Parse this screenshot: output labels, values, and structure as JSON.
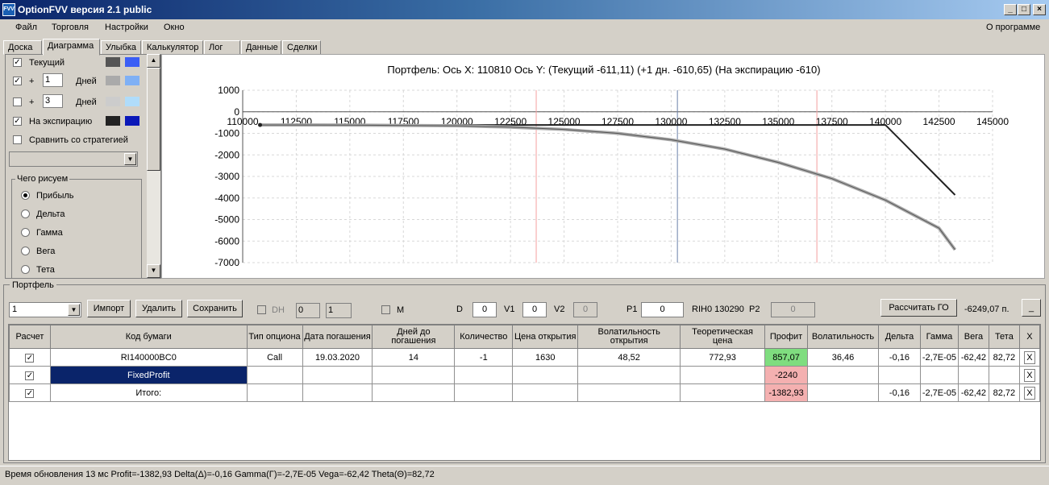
{
  "window": {
    "title": "OptionFVV версия 2.1 public",
    "icon_text": "FVV"
  },
  "menu": {
    "items": [
      "Файл",
      "Торговля",
      "Настройки",
      "Окно"
    ],
    "about": "О программе"
  },
  "tabs": [
    "Доска",
    "Диаграмма",
    "Улыбка",
    "Калькулятор",
    "Лог",
    "Данные",
    "Сделки"
  ],
  "left": {
    "current": "Текущий",
    "plus": "+",
    "days_label": "Дней",
    "days1": "1",
    "days2": "3",
    "expiry": "На экспирацию",
    "compare": "Сравнить со стратегией",
    "what_title": "Чего рисуем",
    "radios": [
      "Прибыль",
      "Дельта",
      "Гамма",
      "Вега",
      "Тета"
    ],
    "colors": {
      "current_dark": "#555555",
      "current_light": "#3b5ef5",
      "d1_dark": "#aaaaaa",
      "d1_light": "#7fb0f5",
      "d3_dark": "#cccccc",
      "d3_light": "#b0dcfa",
      "exp_dark": "#222222",
      "exp_light": "#0a18b8"
    }
  },
  "chart_title": "Портфель: Ось X: 110810 Ось Y:  (Текущий -611,11)  (+1 дн. -610,65)  (На экспирацию -610)",
  "chart_data": {
    "type": "line",
    "xlim": [
      110000,
      145000
    ],
    "ylim": [
      -7000,
      1000
    ],
    "x_ticks": [
      110000,
      112500,
      115000,
      117500,
      120000,
      122500,
      125000,
      127500,
      130000,
      132500,
      135000,
      137500,
      140000,
      142500,
      145000
    ],
    "y_ticks": [
      1000,
      0,
      -1000,
      -2000,
      -3000,
      -4000,
      -5000,
      -6000,
      -7000
    ],
    "x_tick_labels": [
      "110000",
      "112500",
      "115000",
      "117500",
      "120000",
      "122500",
      "125000",
      "127500",
      "130000",
      "132500",
      "135000",
      "137500",
      "140000",
      "142500",
      "145000"
    ],
    "y_tick_labels": [
      "1000",
      "0",
      "-1000",
      "-2000",
      "-3000",
      "-4000",
      "-5000",
      "-6000",
      "-7000"
    ],
    "vlines": [
      {
        "x": 123700,
        "color": "#f4a0a0"
      },
      {
        "x": 130290,
        "color": "#6a7fa8"
      },
      {
        "x": 136800,
        "color": "#f4a0a0"
      }
    ],
    "series": [
      {
        "color": "#222222",
        "width": 2,
        "x": [
          110810,
          140000,
          143250
        ],
        "y": [
          -610,
          -610,
          -3860
        ]
      },
      {
        "color": "#aaaaaa",
        "width": 4,
        "x": [
          110810,
          115000,
          120000,
          122500,
          125000,
          127500,
          130000,
          132500,
          135000,
          137500,
          140000,
          142500,
          143250
        ],
        "y": [
          -611,
          -615,
          -650,
          -710,
          -820,
          -1000,
          -1300,
          -1730,
          -2350,
          -3100,
          -4100,
          -5400,
          -6400
        ]
      },
      {
        "color": "#555555",
        "width": 1,
        "x": [
          110810,
          115000,
          120000,
          122500,
          125000,
          127500,
          130000,
          132500,
          135000,
          137500,
          140000,
          142500,
          143250
        ],
        "y": [
          -611,
          -615,
          -650,
          -710,
          -820,
          -1000,
          -1300,
          -1730,
          -2350,
          -3100,
          -4100,
          -5400,
          -6400
        ]
      }
    ]
  },
  "portfolio": {
    "group_label": "Портфель",
    "selector_value": "1",
    "import": "Импорт",
    "delete": "Удалить",
    "save": "Сохранить",
    "dh": "DH",
    "spin1": "0",
    "spin2": "1",
    "m": "M",
    "d_label": "D",
    "d_value": "0",
    "v1_label": "V1",
    "v1_value": "0",
    "v2_label": "V2",
    "v2_value": "0",
    "p1_label": "P1",
    "p1_value": "0",
    "instrument": "RIH0 130290",
    "p2_label": "P2",
    "p2_value": "0",
    "calc_go": "Рассчитать ГО",
    "go_value": "-6249,07 п.",
    "min_btn": "_"
  },
  "table": {
    "headers": [
      "Расчет",
      "Код бумаги",
      "Тип опциона",
      "Дата погашения",
      "Дней до погашения",
      "Количество",
      "Цена открытия",
      "Волатильность открытия",
      "Теоретическая цена",
      "Профит",
      "Волатильность",
      "Дельта",
      "Гамма",
      "Вега",
      "Тета",
      "X"
    ],
    "rows": [
      {
        "cells": [
          "RI140000BC0",
          "Call",
          "19.03.2020",
          "14",
          "-1",
          "1630",
          "48,52",
          "772,93",
          "857,07",
          "36,46",
          "-0,16",
          "-2,7E-05",
          "-62,42",
          "82,72"
        ],
        "profit_status": "g"
      },
      {
        "cells": [
          "FixedProfit",
          "",
          "",
          "",
          "",
          "",
          "",
          "",
          "-2240",
          "",
          "",
          "",
          "",
          ""
        ],
        "profit_status": "r"
      },
      {
        "cells": [
          "Итого:",
          "",
          "",
          "",
          "",
          "",
          "",
          "",
          "-1382,93",
          "",
          "-0,16",
          "-2,7E-05",
          "-62,42",
          "82,72"
        ],
        "profit_status": "r"
      }
    ]
  },
  "status": "Время обновления 13 мс  Profit=-1382,93 Delta(Δ)=-0,16 Gamma(Γ)=-2,7E-05 Vega=-62,42 Theta(Θ)=82,72"
}
